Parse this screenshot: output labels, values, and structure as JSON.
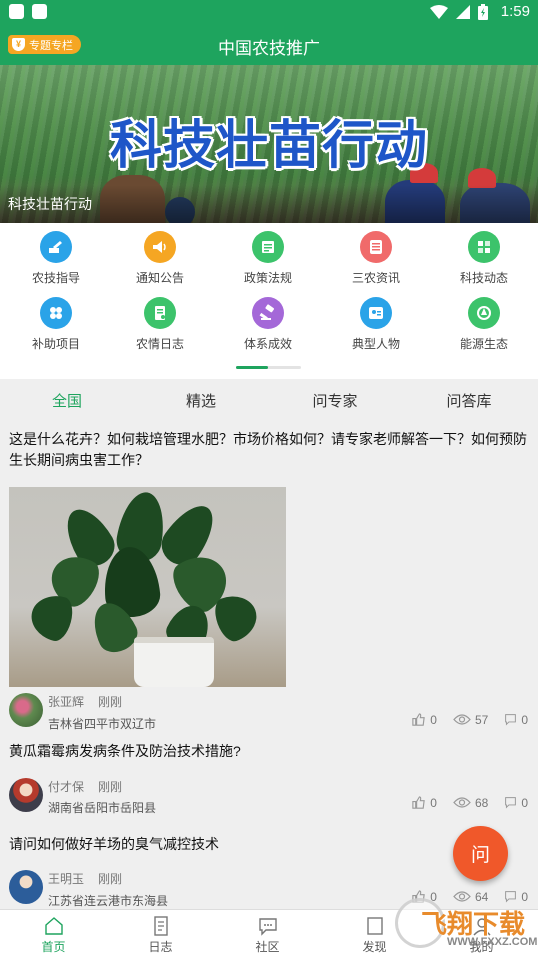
{
  "status_bar": {
    "time": "1:59"
  },
  "app_bar": {
    "title": "中国农技推广",
    "special_label": "专题专栏"
  },
  "banner": {
    "headline": "科技壮苗行动",
    "caption": "科技壮苗行动"
  },
  "categories": [
    {
      "label": "农技指导",
      "color": "#2aa3e8",
      "icon": "guide-icon"
    },
    {
      "label": "通知公告",
      "color": "#f5a623",
      "icon": "speaker-icon"
    },
    {
      "label": "政策法规",
      "color": "#3cc36b",
      "icon": "document-icon"
    },
    {
      "label": "三农资讯",
      "color": "#f06a6a",
      "icon": "news-icon"
    },
    {
      "label": "科技动态",
      "color": "#3cc36b",
      "icon": "tech-icon"
    },
    {
      "label": "补助项目",
      "color": "#2aa3e8",
      "icon": "grid-icon"
    },
    {
      "label": "农情日志",
      "color": "#3cc36b",
      "icon": "log-icon"
    },
    {
      "label": "体系成效",
      "color": "#a468d8",
      "icon": "gavel-icon"
    },
    {
      "label": "典型人物",
      "color": "#2aa3e8",
      "icon": "person-icon"
    },
    {
      "label": "能源生态",
      "color": "#3cc36b",
      "icon": "eco-icon"
    }
  ],
  "tabs": [
    "全国",
    "精选",
    "问专家",
    "问答库"
  ],
  "posts": [
    {
      "question": "这是什么花卉？如何栽培管理水肥？市场价格如何？请专家老师解答一下？如何预防生长期间病虫害工作？",
      "author": "张亚辉",
      "time": "刚刚",
      "location": "吉林省四平市双辽市",
      "likes": "0",
      "views": "57",
      "comments": "0"
    },
    {
      "question": "黄瓜霜霉病发病条件及防治技术措施?",
      "author": "付才保",
      "time": "刚刚",
      "location": "湖南省岳阳市岳阳县",
      "likes": "0",
      "views": "68",
      "comments": "0"
    },
    {
      "question": "请问如何做好羊场的臭气减控技术",
      "author": "王明玉",
      "time": "刚刚",
      "location": "江苏省连云港市东海县",
      "likes": "0",
      "views": "64",
      "comments": "0"
    }
  ],
  "fab_label": "问",
  "bottom_nav": [
    "首页",
    "日志",
    "社区",
    "发现",
    "我的"
  ],
  "watermark": {
    "brand": "飞翔下载",
    "url": "WWW.FXXZ.COM"
  },
  "colors": {
    "primary": "#1ea45e",
    "fab": "#f0582a",
    "badge": "#f5a623"
  }
}
